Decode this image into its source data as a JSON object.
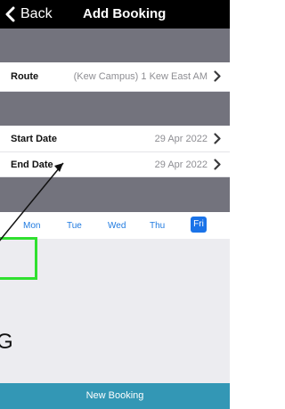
{
  "navbar": {
    "back_label": "Back",
    "title": "Add Booking"
  },
  "route": {
    "label": "Route",
    "value": "(Kew Campus) 1 Kew East AM"
  },
  "start_date": {
    "label": "Start Date",
    "value": "29 Apr 2022"
  },
  "end_date": {
    "label": "End Date",
    "value": "29 Apr 2022"
  },
  "days": {
    "mon": "Mon",
    "tue": "Tue",
    "wed": "Wed",
    "thu": "Thu",
    "fri": "Fri",
    "selected": "Fri"
  },
  "content": {
    "letter": "G"
  },
  "footer": {
    "new_booking_label": "New Booking"
  },
  "colors": {
    "navbar_bg": "#000000",
    "section_band": "#73737d",
    "accent_blue": "#1a73e8",
    "footer_bg": "#3397b5",
    "highlight_green": "#2fe02f"
  }
}
